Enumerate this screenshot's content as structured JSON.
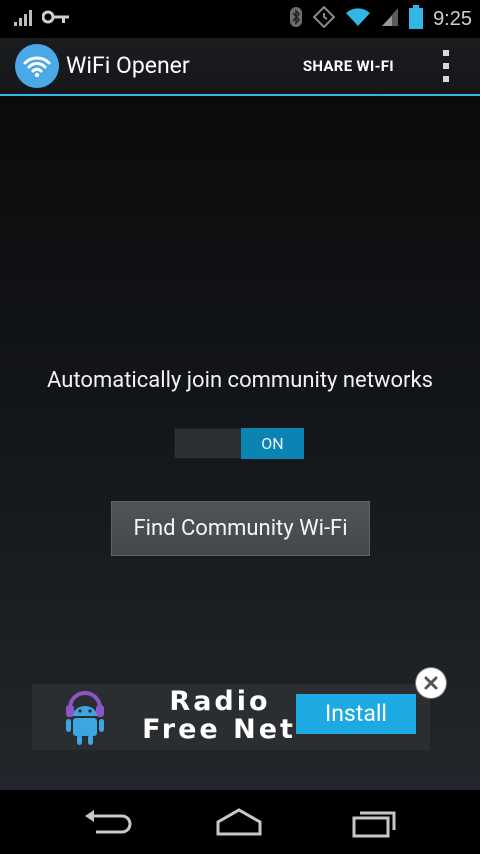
{
  "statusbar": {
    "time": "9:25",
    "icons": [
      "signal-icon",
      "key-icon",
      "bluetooth-icon",
      "alarm-icon",
      "wifi-icon",
      "cell-signal-icon",
      "battery-icon"
    ]
  },
  "actionbar": {
    "title": "WiFi Opener",
    "share_label": "SHARE WI-FI",
    "accent_color": "#33b5e5"
  },
  "main": {
    "auto_join_label": "Automatically join community networks",
    "toggle_state": "ON",
    "find_button_label": "Find Community Wi-Fi"
  },
  "ad": {
    "line1": "Radio",
    "line2": "Free Net",
    "install_label": "Install",
    "install_color": "#1da9e1"
  },
  "navbar": {
    "buttons": [
      "back-icon",
      "home-icon",
      "recent-apps-icon"
    ]
  }
}
